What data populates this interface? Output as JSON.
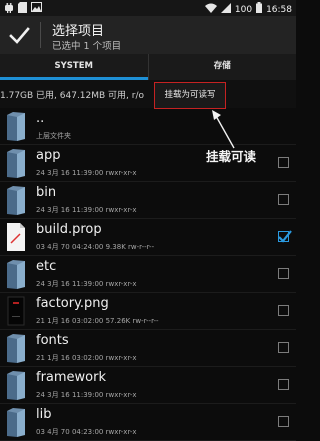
{
  "status_bar": {
    "battery": "100",
    "time": "16:58",
    "icons": [
      "android-icon",
      "sd-card-icon",
      "image-icon",
      "wifi-icon",
      "signal-icon",
      "battery-icon"
    ]
  },
  "header": {
    "title": "选择项目",
    "subtitle": "已选中 1 个项目"
  },
  "tabs": [
    {
      "label": "SYSTEM",
      "active": true
    },
    {
      "label": "存储",
      "active": false
    }
  ],
  "info": {
    "text": "1.77GB 已用, 647.12MB 可用, r/o",
    "remount_label": "挂载为可读写"
  },
  "callout": {
    "text": "挂载可读"
  },
  "accent_color": "#1e90d6",
  "highlight_color": "#c52222",
  "files": [
    {
      "name": "..",
      "meta": "上层文件夹",
      "type": "folder",
      "checkbox": false,
      "checked": false
    },
    {
      "name": "app",
      "meta": "24 3月 16 11:39:00   rwxr-xr-x",
      "type": "folder",
      "checkbox": true,
      "checked": false
    },
    {
      "name": "bin",
      "meta": "24 3月 16 11:39:00   rwxr-xr-x",
      "type": "folder",
      "checkbox": true,
      "checked": false
    },
    {
      "name": "build.prop",
      "meta": "03 4月 70 04:24:00  9.38K  rw-r--r--",
      "type": "file",
      "checkbox": true,
      "checked": true
    },
    {
      "name": "etc",
      "meta": "24 3月 16 11:39:00   rwxr-xr-x",
      "type": "folder",
      "checkbox": true,
      "checked": false
    },
    {
      "name": "factory.png",
      "meta": "21 1月 16 03:02:00  57.26K  rw-r--r--",
      "type": "image",
      "checkbox": true,
      "checked": false
    },
    {
      "name": "fonts",
      "meta": "21 1月 16 03:02:00   rwxr-xr-x",
      "type": "folder",
      "checkbox": true,
      "checked": false
    },
    {
      "name": "framework",
      "meta": "24 3月 16 11:39:00   rwxr-xr-x",
      "type": "folder",
      "checkbox": true,
      "checked": false
    },
    {
      "name": "lib",
      "meta": "03 4月 70 04:23:00   rwxr-xr-x",
      "type": "folder",
      "checkbox": true,
      "checked": false
    }
  ]
}
